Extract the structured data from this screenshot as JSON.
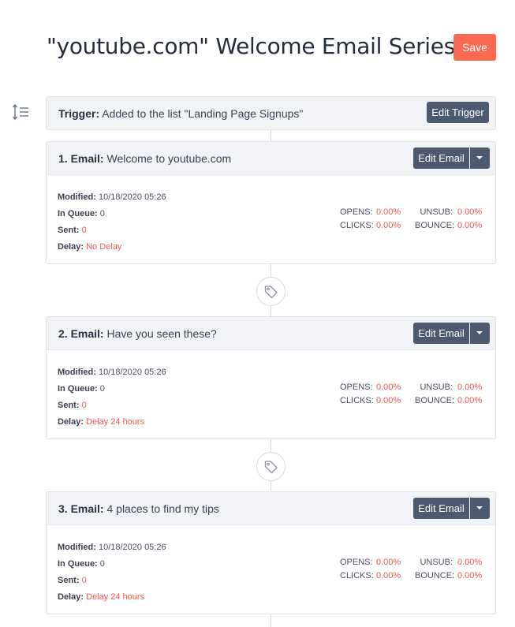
{
  "page": {
    "title": "\"youtube.com\" Welcome Email Series",
    "save_label": "Save"
  },
  "icons": {
    "reorder": "reorder-icon",
    "tag": "tag-icon",
    "caret": "caret-down-icon"
  },
  "colors": {
    "save_button": "#fa6a52",
    "dark_button": "#4d596d",
    "accent_red": "#f05a4a",
    "header_bg": "#f1f3f7"
  },
  "trigger": {
    "label": "Trigger:",
    "text": "Added to the list \"Landing Page Signups\"",
    "edit_label": "Edit Trigger"
  },
  "emails": [
    {
      "label": "1. Email:",
      "subject": "Welcome to youtube.com",
      "edit_label": "Edit Email",
      "modified_label": "Modified:",
      "modified": "10/18/2020 05:26",
      "queue_label": "In Queue:",
      "queue": "0",
      "sent_label": "Sent:",
      "sent": "0",
      "delay_label": "Delay:",
      "delay": "No Delay",
      "opens_label": "OPENS:",
      "opens": "0.00%",
      "clicks_label": "CLICKS:",
      "clicks": "0.00%",
      "unsub_label": "UNSUB:",
      "unsub": "0.00%",
      "bounce_label": "BOUNCE:",
      "bounce": "0.00%"
    },
    {
      "label": "2. Email:",
      "subject": "Have you seen these?",
      "edit_label": "Edit Email",
      "modified_label": "Modified:",
      "modified": "10/18/2020 05:26",
      "queue_label": "In Queue:",
      "queue": "0",
      "sent_label": "Sent:",
      "sent": "0",
      "delay_label": "Delay:",
      "delay": "Delay 24 hours",
      "opens_label": "OPENS:",
      "opens": "0.00%",
      "clicks_label": "CLICKS:",
      "clicks": "0.00%",
      "unsub_label": "UNSUB:",
      "unsub": "0.00%",
      "bounce_label": "BOUNCE:",
      "bounce": "0.00%"
    },
    {
      "label": "3. Email:",
      "subject": "4 places to find my tips",
      "edit_label": "Edit Email",
      "modified_label": "Modified:",
      "modified": "10/18/2020 05:26",
      "queue_label": "In Queue:",
      "queue": "0",
      "sent_label": "Sent:",
      "sent": "0",
      "delay_label": "Delay:",
      "delay": "Delay 24 hours",
      "opens_label": "OPENS:",
      "opens": "0.00%",
      "clicks_label": "CLICKS:",
      "clicks": "0.00%",
      "unsub_label": "UNSUB:",
      "unsub": "0.00%",
      "bounce_label": "BOUNCE:",
      "bounce": "0.00%"
    }
  ]
}
